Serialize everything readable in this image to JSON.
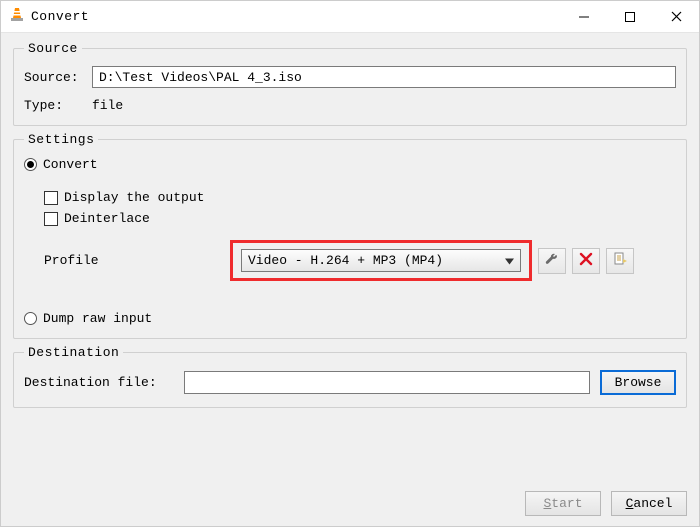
{
  "window": {
    "title": "Convert"
  },
  "source": {
    "legend": "Source",
    "label": "Source:",
    "value": "D:\\Test Videos\\PAL 4_3.iso",
    "type_label": "Type:",
    "type_value": "file"
  },
  "settings": {
    "legend": "Settings",
    "convert_label": "Convert",
    "display_output_label": "Display the output",
    "deinterlace_label": "Deinterlace",
    "profile_label": "Profile",
    "profile_value": "Video - H.264 + MP3 (MP4)",
    "dump_raw_label": "Dump raw input"
  },
  "destination": {
    "legend": "Destination",
    "label": "Destination file:",
    "value": "",
    "browse_label": "Browse"
  },
  "footer": {
    "start_label": "Start",
    "cancel_label": "Cancel"
  }
}
